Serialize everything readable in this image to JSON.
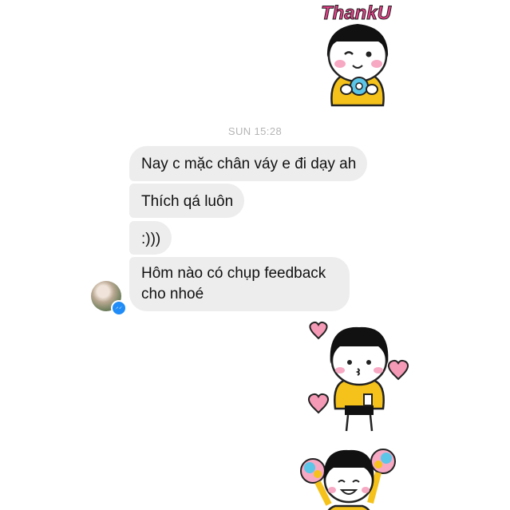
{
  "conversation": {
    "timestamp": "SUN 15:28",
    "messages": [
      {
        "lines": [
          "Nay c mặc chân váy e đi dạy ah"
        ]
      },
      {
        "lines": [
          "Thích qá luôn"
        ]
      },
      {
        "lines": [
          ":)))"
        ]
      },
      {
        "lines": [
          "Hôm nào có chụp feedback",
          "cho nhoé"
        ]
      }
    ]
  },
  "stickers": {
    "thank_you_text": "ThankU"
  },
  "colors": {
    "bubble_bg": "#ededed",
    "timestamp": "#b5b5b5",
    "messenger_blue": "#1f8cf7",
    "sticker_yellow": "#f5c21b",
    "sticker_pink": "#e8408a"
  },
  "icons": {
    "sender_badge": "messenger-icon",
    "avatar": "contact-avatar"
  }
}
